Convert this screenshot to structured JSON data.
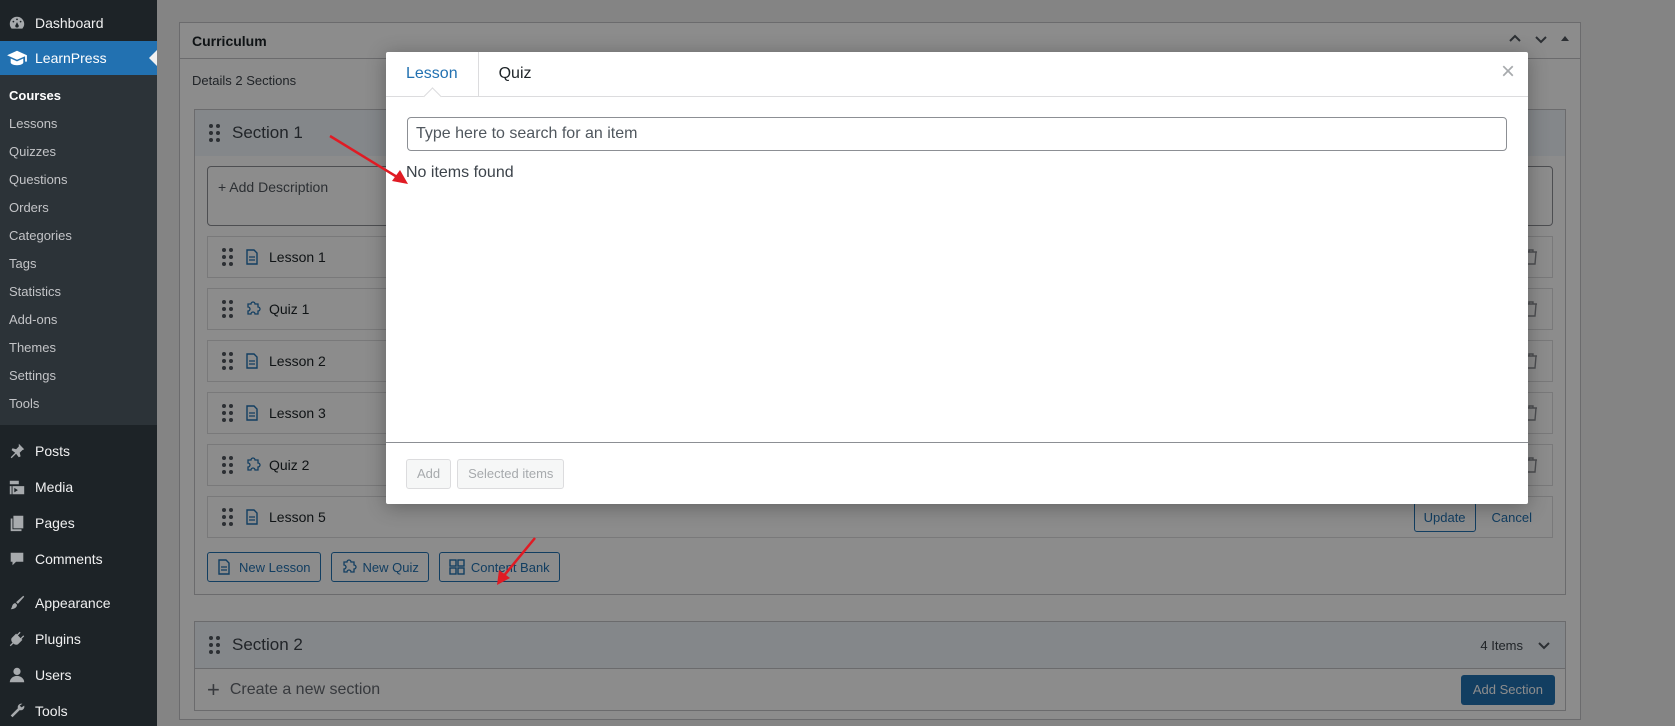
{
  "sidebar": {
    "dashboard": "Dashboard",
    "learnpress": "LearnPress",
    "submenu": [
      "Courses",
      "Lessons",
      "Quizzes",
      "Questions",
      "Orders",
      "Categories",
      "Tags",
      "Statistics",
      "Add-ons",
      "Themes",
      "Settings",
      "Tools"
    ],
    "menu": [
      "Posts",
      "Media",
      "Pages",
      "Comments",
      "Appearance",
      "Plugins",
      "Users",
      "Tools"
    ]
  },
  "curriculum": {
    "title": "Curriculum",
    "details_label": "Details",
    "details_count": "2 Sections",
    "section1": {
      "title": "Section 1",
      "add_description": "+ Add Description",
      "items": [
        {
          "type": "lesson",
          "title": "Lesson 1"
        },
        {
          "type": "quiz",
          "title": "Quiz 1"
        },
        {
          "type": "lesson",
          "title": "Lesson 2"
        },
        {
          "type": "lesson",
          "title": "Lesson 3"
        },
        {
          "type": "quiz",
          "title": "Quiz 2"
        }
      ],
      "editing_item": "Lesson 5",
      "update_label": "Update",
      "cancel_label": "Cancel",
      "new_lesson": "New Lesson",
      "new_quiz": "New Quiz",
      "content_bank": "Content Bank"
    },
    "section2": {
      "title": "Section 2",
      "count": "4 Items"
    },
    "new_section_placeholder": "Create a new section",
    "add_section": "Add Section"
  },
  "modal": {
    "tabs": [
      "Lesson",
      "Quiz"
    ],
    "active_tab": "Lesson",
    "search_placeholder": "Type here to search for an item",
    "empty_message": "No items found",
    "add_button": "Add",
    "selected_button": "Selected items"
  },
  "colors": {
    "accent": "#2271b1",
    "sidebar_bg": "#1d2327",
    "annotation_arrow": "#e01b24"
  }
}
